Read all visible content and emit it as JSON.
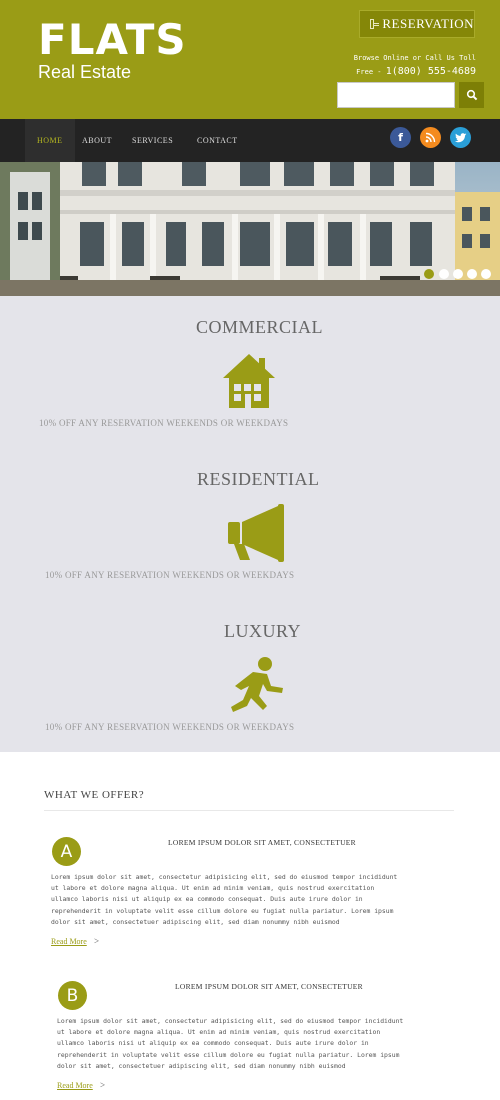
{
  "header": {
    "logo_main": "FLATS",
    "logo_sub": "Real Estate",
    "reservation_label": "RESERVATION",
    "contact_text": "Browse Online or Call Us Toll",
    "contact_free": "Free - ",
    "contact_phone": "1(800) 555-4689",
    "search_placeholder": "",
    "search_icon": "search-icon"
  },
  "nav": {
    "items": [
      {
        "label": "HOME",
        "active": true
      },
      {
        "label": "ABOUT"
      },
      {
        "label": "SERVICES"
      },
      {
        "label": "CONTACT"
      }
    ],
    "social": [
      {
        "label": "f",
        "icon": "facebook-icon",
        "color": "#3b5998"
      },
      {
        "label": "rss",
        "icon": "rss-icon",
        "color": "#f48b1f"
      },
      {
        "label": "t",
        "icon": "twitter-icon",
        "color": "#2a9fd8"
      }
    ]
  },
  "banner": {
    "slides": 5,
    "active_slide": 1
  },
  "services": [
    {
      "title": "COMMERCIAL",
      "icon": "house-icon",
      "desc": "10% OFF ANY RESERVATION WEEKENDS OR WEEKDAYS"
    },
    {
      "title": "RESIDENTIAL",
      "icon": "megaphone-icon",
      "desc": "10% OFF ANY RESERVATION WEEKENDS OR WEEKDAYS"
    },
    {
      "title": "LUXURY",
      "icon": "walking-person-icon",
      "desc": "10% OFF ANY RESERVATION WEEKENDS OR WEEKDAYS"
    }
  ],
  "offer": {
    "title": "WHAT WE OFFER?",
    "items": [
      {
        "badge": "A",
        "heading": "LOREM IPSUM DOLOR SIT AMET, CONSECTETUER",
        "lines": [
          "Lorem ipsum dolor sit amet, consectetur adipisicing elit, sed do eiusmod tempor incididunt",
          "ut labore et dolore magna aliqua. Ut enim ad minim veniam, quis nostrud exercitation",
          "ullamco laboris nisi ut aliquip ex ea commodo consequat. Duis aute irure dolor in",
          "reprehenderit in voluptate velit esse cillum dolore eu fugiat nulla pariatur. Lorem ipsum",
          "dolor sit amet, consectetuer adipiscing elit, sed diam nonummy nibh euismod"
        ],
        "read_more": "Read More",
        "arrow": ">"
      },
      {
        "badge": "B",
        "heading": "LOREM IPSUM DOLOR SIT AMET, CONSECTETUER",
        "lines": [
          "Lorem ipsum dolor sit amet, consectetur adipisicing elit, sed do eiusmod tempor incididunt",
          "ut labore et dolore magna aliqua. Ut enim ad minim veniam, quis nostrud exercitation",
          "ullamco laboris nisi ut aliquip ex ea commodo consequat. Duis aute irure dolor in",
          "reprehenderit in voluptate velit esse cillum dolore eu fugiat nulla pariatur. Lorem ipsum",
          "dolor sit amet, consectetuer adipiscing elit, sed diam nonummy nibh euismod"
        ],
        "read_more": "Read More",
        "arrow": ">"
      }
    ]
  },
  "colors": {
    "brand": "#9a9c16",
    "nav_bg": "#232323",
    "services_bg": "#e4e4ea"
  }
}
